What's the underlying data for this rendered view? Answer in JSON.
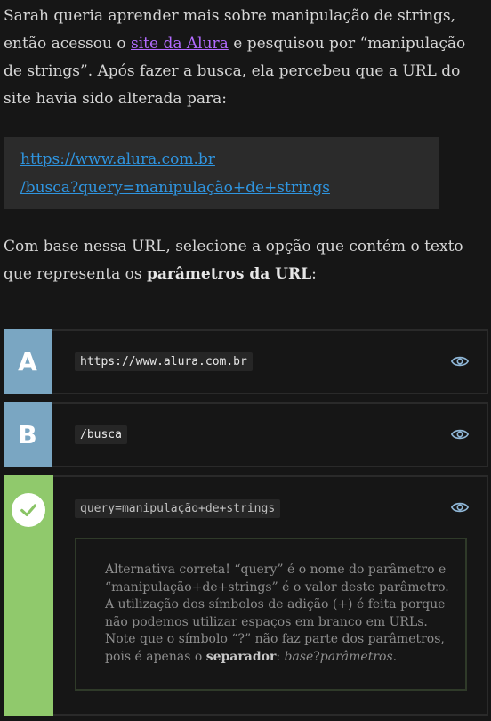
{
  "intro": {
    "part1": "Sarah queria aprender mais sobre manipulação de strings, então acessou o ",
    "link_text": "site da Alura",
    "part2": " e pesquisou por “manipulação de strings”. Após fazer a busca, ela percebeu que a URL do site havia sido alterada para:"
  },
  "url": {
    "line1": "https://www.alura.com.br",
    "line2": "/busca?query=manipulação+de+strings"
  },
  "question": {
    "part1": "Com base nessa URL, selecione a opção que contém o texto que representa os ",
    "bold": "parâmetros da URL",
    "part2": ":"
  },
  "options": [
    {
      "letter": "A",
      "code": "https://www.alura.com.br"
    },
    {
      "letter": "B",
      "code": "/busca"
    },
    {
      "letter": "",
      "code": "query=manipulação+de+strings"
    }
  ],
  "feedback": {
    "text1": "Alternativa correta! “query” é o nome do parâmetro e “manipulação+de+strings” é o valor deste parâmetro. A utilização dos símbolos de adição (+) é feita porque não podemos utilizar espaços em branco em URLs. Note que o símbolo “?” não faz parte dos parâmetros, pois é apenas o ",
    "bold": "separador",
    "text2": ": ",
    "italic1": "base",
    "sep": "?",
    "italic2": "parâmetros",
    "end": "."
  },
  "icons": {
    "eye": "eye-icon",
    "check": "check-circle-icon"
  },
  "colors": {
    "accent_letter": "#7aa6c2",
    "correct": "#90c96c",
    "link": "#b36bff",
    "url_link": "#2f95e0"
  }
}
